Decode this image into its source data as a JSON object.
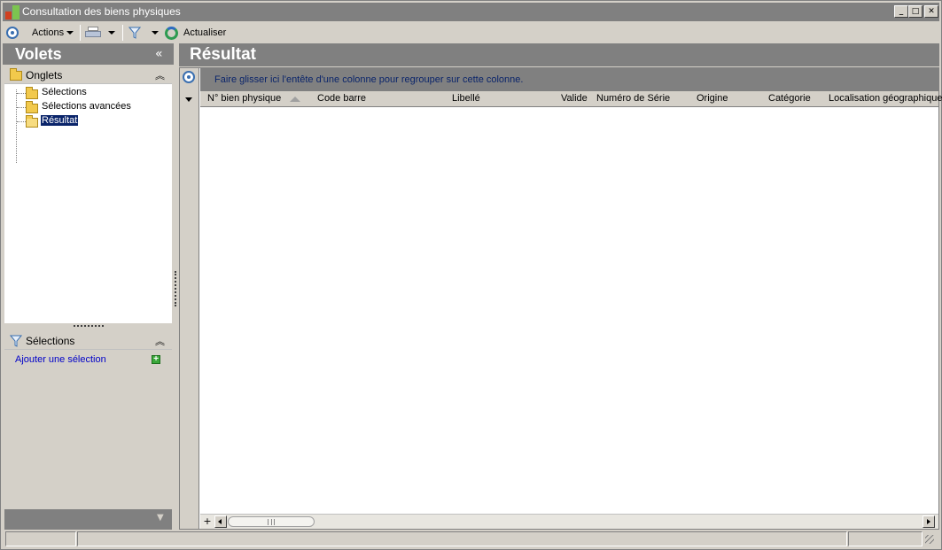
{
  "window": {
    "title": "Consultation des biens physiques"
  },
  "toolbar": {
    "actions_label": "Actions",
    "refresh_label": "Actualiser"
  },
  "left_pane": {
    "title": "Volets",
    "collapse_glyph": "«",
    "tabs_group": {
      "label": "Onglets",
      "items": [
        {
          "label": "Sélections"
        },
        {
          "label": "Sélections avancées"
        },
        {
          "label": "Résultat",
          "selected": true
        }
      ]
    },
    "selections_group": {
      "label": "Sélections",
      "add_link": "Ajouter une sélection"
    }
  },
  "right_pane": {
    "title": "Résultat",
    "group_hint": "Faire glisser ici l'entête d'une colonne pour regrouper sur cette colonne.",
    "columns": [
      {
        "label": "N° bien physique"
      },
      {
        "label": "Code barre"
      },
      {
        "label": "Libellé"
      },
      {
        "label": "Valide"
      },
      {
        "label": "Numéro de Série"
      },
      {
        "label": "Origine"
      },
      {
        "label": "Catégorie"
      },
      {
        "label": "Localisation géographique"
      }
    ]
  },
  "colors": {
    "header_gray": "#808080",
    "face": "#d4d0c8",
    "selection": "#0a246a",
    "link": "#0000c8"
  }
}
